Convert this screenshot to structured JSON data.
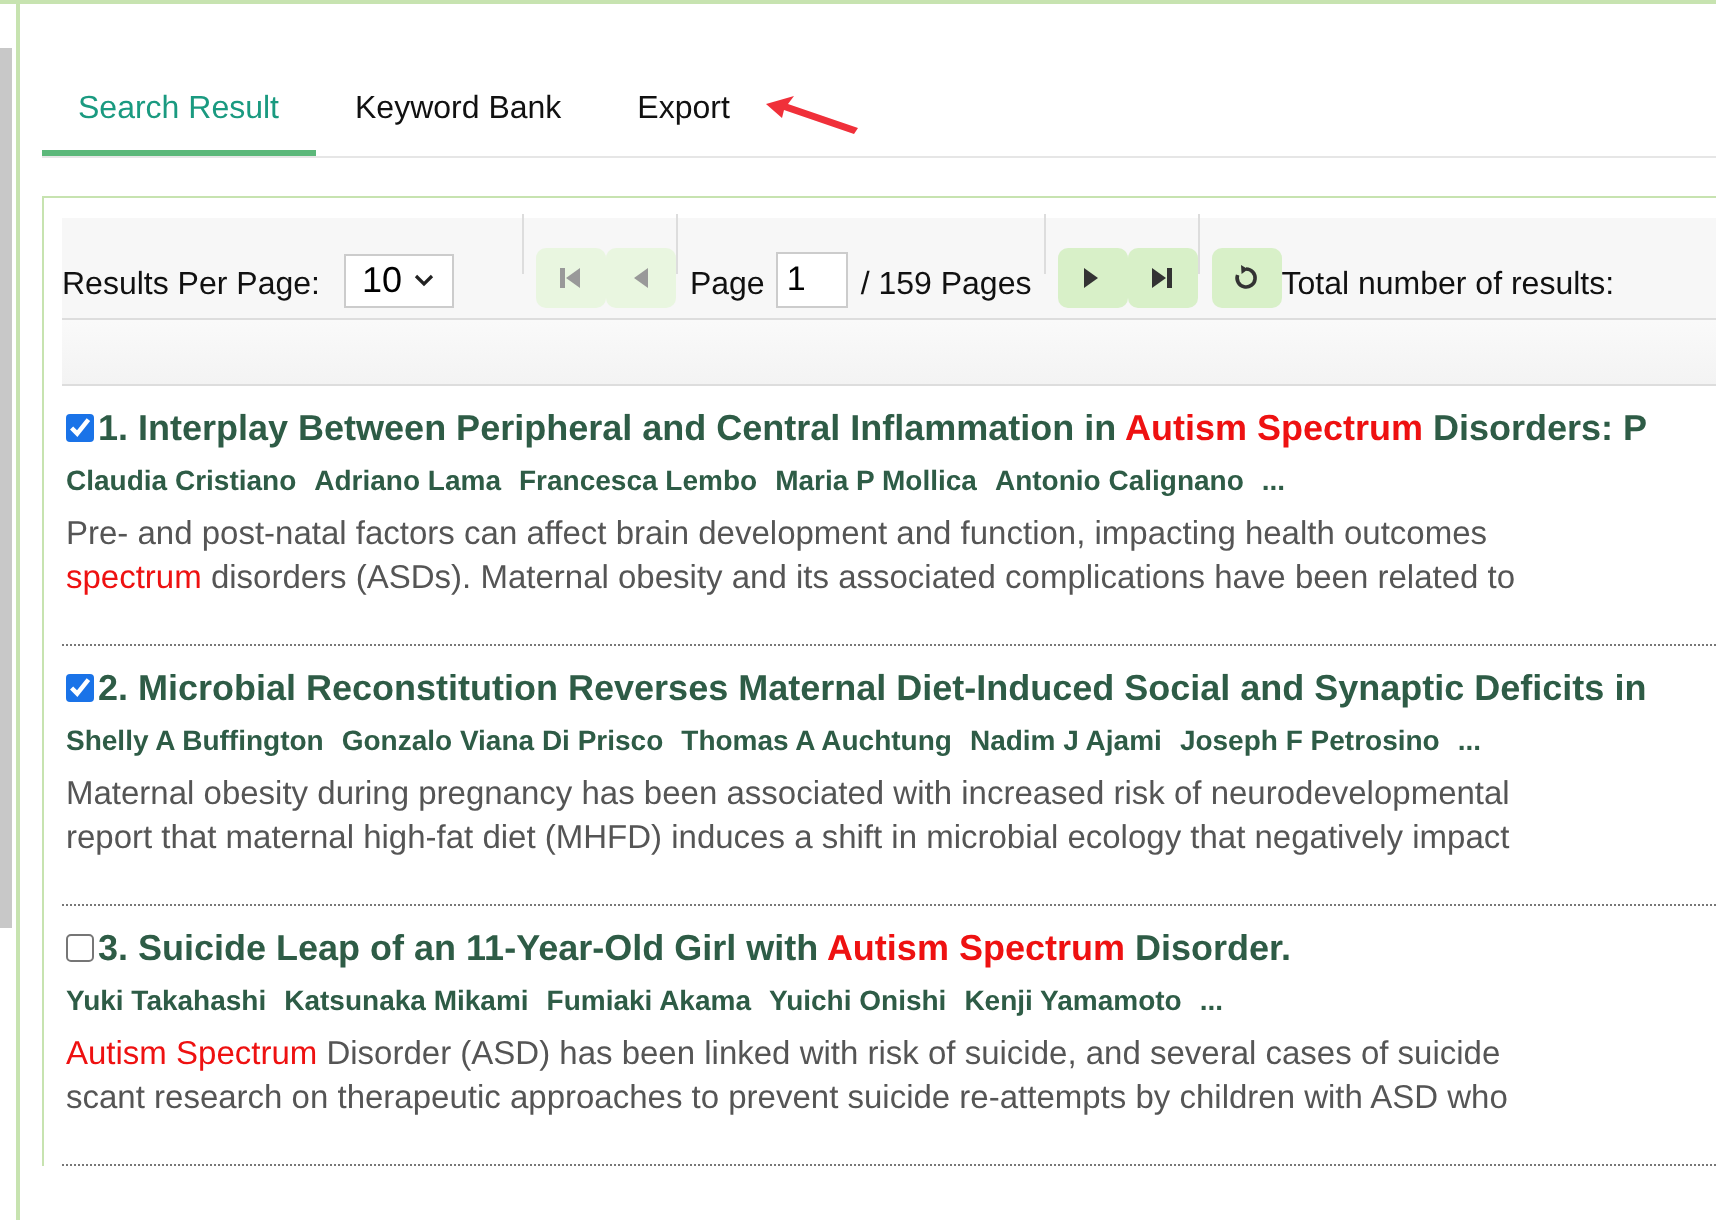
{
  "tabs": [
    {
      "label": "Search Result",
      "selected": true
    },
    {
      "label": "Keyword Bank",
      "selected": false
    },
    {
      "label": "Export",
      "selected": false
    }
  ],
  "toolbar": {
    "per_page_label": "Results Per Page:",
    "per_page_value": "10",
    "page_label": "Page",
    "page_value": "1",
    "pages_text": "/ 159 Pages",
    "total_label": "Total number of results:",
    "nav_buttons": [
      {
        "kind": "first",
        "disabled": true
      },
      {
        "kind": "prev",
        "disabled": true
      },
      {
        "kind": "next",
        "disabled": false
      },
      {
        "kind": "last",
        "disabled": false
      },
      {
        "kind": "refresh",
        "disabled": false
      }
    ]
  },
  "results": [
    {
      "checked": true,
      "title": [
        {
          "text": "1. Interplay Between Peripheral and Central Inflammation in ",
          "highlight": false
        },
        {
          "text": "Autism Spectrum",
          "highlight": true
        },
        {
          "text": " Disorders: P",
          "highlight": false
        }
      ],
      "authors": [
        "Claudia Cristiano",
        "Adriano Lama",
        "Francesca Lembo",
        "Maria P Mollica",
        "Antonio Calignano",
        "..."
      ],
      "abstract_lines": [
        [
          {
            "text": "Pre- and post-natal factors can affect brain development and function, impacting health outcomes",
            "highlight": false
          }
        ],
        [
          {
            "text": "spectrum",
            "highlight": true
          },
          {
            "text": " disorders (ASDs). Maternal obesity and its associated complications have been related to",
            "highlight": false
          }
        ]
      ]
    },
    {
      "checked": true,
      "title": [
        {
          "text": "2. Microbial Reconstitution Reverses Maternal Diet-Induced Social and Synaptic Deficits in",
          "highlight": false
        }
      ],
      "authors": [
        "Shelly A Buffington",
        "Gonzalo Viana Di Prisco",
        "Thomas A Auchtung",
        "Nadim J Ajami",
        "Joseph F Petrosino",
        "..."
      ],
      "abstract_lines": [
        [
          {
            "text": "Maternal obesity during pregnancy has been associated with increased risk of neurodevelopmental",
            "highlight": false
          }
        ],
        [
          {
            "text": "report that maternal high-fat diet (MHFD) induces a shift in microbial ecology that negatively impact",
            "highlight": false
          }
        ]
      ]
    },
    {
      "checked": false,
      "title": [
        {
          "text": "3. Suicide Leap of an 11-Year-Old Girl with ",
          "highlight": false
        },
        {
          "text": "Autism Spectrum",
          "highlight": true
        },
        {
          "text": " Disorder.",
          "highlight": false
        }
      ],
      "authors": [
        "Yuki Takahashi",
        "Katsunaka Mikami",
        "Fumiaki Akama",
        "Yuichi Onishi",
        "Kenji Yamamoto",
        "..."
      ],
      "abstract_lines": [
        [
          {
            "text": "Autism Spectrum",
            "highlight": true
          },
          {
            "text": " Disorder (ASD) has been linked with risk of suicide, and several cases of suicide",
            "highlight": false
          }
        ],
        [
          {
            "text": "scant research on therapeutic approaches to prevent suicide re-attempts by children with ASD who",
            "highlight": false
          }
        ]
      ]
    }
  ]
}
